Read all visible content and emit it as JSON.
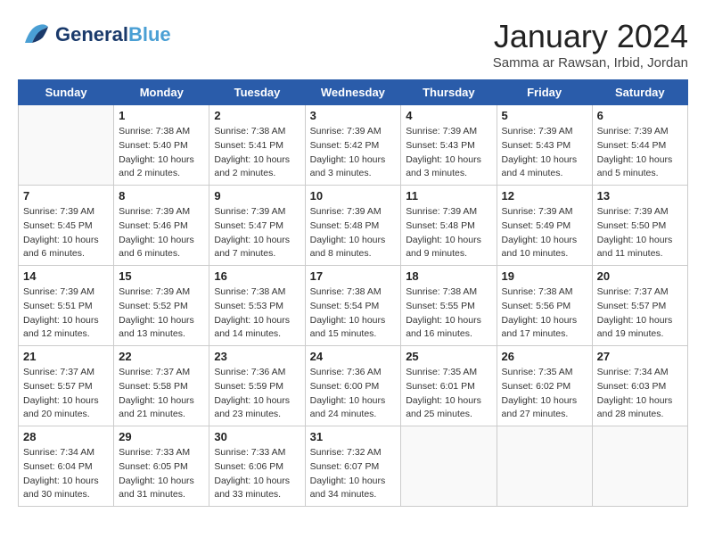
{
  "header": {
    "logo_general": "General",
    "logo_blue": "Blue",
    "month_title": "January 2024",
    "location": "Samma ar Rawsan, Irbid, Jordan"
  },
  "days_of_week": [
    "Sunday",
    "Monday",
    "Tuesday",
    "Wednesday",
    "Thursday",
    "Friday",
    "Saturday"
  ],
  "weeks": [
    [
      {
        "day": "",
        "info": ""
      },
      {
        "day": "1",
        "info": "Sunrise: 7:38 AM\nSunset: 5:40 PM\nDaylight: 10 hours\nand 2 minutes."
      },
      {
        "day": "2",
        "info": "Sunrise: 7:38 AM\nSunset: 5:41 PM\nDaylight: 10 hours\nand 2 minutes."
      },
      {
        "day": "3",
        "info": "Sunrise: 7:39 AM\nSunset: 5:42 PM\nDaylight: 10 hours\nand 3 minutes."
      },
      {
        "day": "4",
        "info": "Sunrise: 7:39 AM\nSunset: 5:43 PM\nDaylight: 10 hours\nand 3 minutes."
      },
      {
        "day": "5",
        "info": "Sunrise: 7:39 AM\nSunset: 5:43 PM\nDaylight: 10 hours\nand 4 minutes."
      },
      {
        "day": "6",
        "info": "Sunrise: 7:39 AM\nSunset: 5:44 PM\nDaylight: 10 hours\nand 5 minutes."
      }
    ],
    [
      {
        "day": "7",
        "info": "Sunrise: 7:39 AM\nSunset: 5:45 PM\nDaylight: 10 hours\nand 6 minutes."
      },
      {
        "day": "8",
        "info": "Sunrise: 7:39 AM\nSunset: 5:46 PM\nDaylight: 10 hours\nand 6 minutes."
      },
      {
        "day": "9",
        "info": "Sunrise: 7:39 AM\nSunset: 5:47 PM\nDaylight: 10 hours\nand 7 minutes."
      },
      {
        "day": "10",
        "info": "Sunrise: 7:39 AM\nSunset: 5:48 PM\nDaylight: 10 hours\nand 8 minutes."
      },
      {
        "day": "11",
        "info": "Sunrise: 7:39 AM\nSunset: 5:48 PM\nDaylight: 10 hours\nand 9 minutes."
      },
      {
        "day": "12",
        "info": "Sunrise: 7:39 AM\nSunset: 5:49 PM\nDaylight: 10 hours\nand 10 minutes."
      },
      {
        "day": "13",
        "info": "Sunrise: 7:39 AM\nSunset: 5:50 PM\nDaylight: 10 hours\nand 11 minutes."
      }
    ],
    [
      {
        "day": "14",
        "info": "Sunrise: 7:39 AM\nSunset: 5:51 PM\nDaylight: 10 hours\nand 12 minutes."
      },
      {
        "day": "15",
        "info": "Sunrise: 7:39 AM\nSunset: 5:52 PM\nDaylight: 10 hours\nand 13 minutes."
      },
      {
        "day": "16",
        "info": "Sunrise: 7:38 AM\nSunset: 5:53 PM\nDaylight: 10 hours\nand 14 minutes."
      },
      {
        "day": "17",
        "info": "Sunrise: 7:38 AM\nSunset: 5:54 PM\nDaylight: 10 hours\nand 15 minutes."
      },
      {
        "day": "18",
        "info": "Sunrise: 7:38 AM\nSunset: 5:55 PM\nDaylight: 10 hours\nand 16 minutes."
      },
      {
        "day": "19",
        "info": "Sunrise: 7:38 AM\nSunset: 5:56 PM\nDaylight: 10 hours\nand 17 minutes."
      },
      {
        "day": "20",
        "info": "Sunrise: 7:37 AM\nSunset: 5:57 PM\nDaylight: 10 hours\nand 19 minutes."
      }
    ],
    [
      {
        "day": "21",
        "info": "Sunrise: 7:37 AM\nSunset: 5:57 PM\nDaylight: 10 hours\nand 20 minutes."
      },
      {
        "day": "22",
        "info": "Sunrise: 7:37 AM\nSunset: 5:58 PM\nDaylight: 10 hours\nand 21 minutes."
      },
      {
        "day": "23",
        "info": "Sunrise: 7:36 AM\nSunset: 5:59 PM\nDaylight: 10 hours\nand 23 minutes."
      },
      {
        "day": "24",
        "info": "Sunrise: 7:36 AM\nSunset: 6:00 PM\nDaylight: 10 hours\nand 24 minutes."
      },
      {
        "day": "25",
        "info": "Sunrise: 7:35 AM\nSunset: 6:01 PM\nDaylight: 10 hours\nand 25 minutes."
      },
      {
        "day": "26",
        "info": "Sunrise: 7:35 AM\nSunset: 6:02 PM\nDaylight: 10 hours\nand 27 minutes."
      },
      {
        "day": "27",
        "info": "Sunrise: 7:34 AM\nSunset: 6:03 PM\nDaylight: 10 hours\nand 28 minutes."
      }
    ],
    [
      {
        "day": "28",
        "info": "Sunrise: 7:34 AM\nSunset: 6:04 PM\nDaylight: 10 hours\nand 30 minutes."
      },
      {
        "day": "29",
        "info": "Sunrise: 7:33 AM\nSunset: 6:05 PM\nDaylight: 10 hours\nand 31 minutes."
      },
      {
        "day": "30",
        "info": "Sunrise: 7:33 AM\nSunset: 6:06 PM\nDaylight: 10 hours\nand 33 minutes."
      },
      {
        "day": "31",
        "info": "Sunrise: 7:32 AM\nSunset: 6:07 PM\nDaylight: 10 hours\nand 34 minutes."
      },
      {
        "day": "",
        "info": ""
      },
      {
        "day": "",
        "info": ""
      },
      {
        "day": "",
        "info": ""
      }
    ]
  ]
}
